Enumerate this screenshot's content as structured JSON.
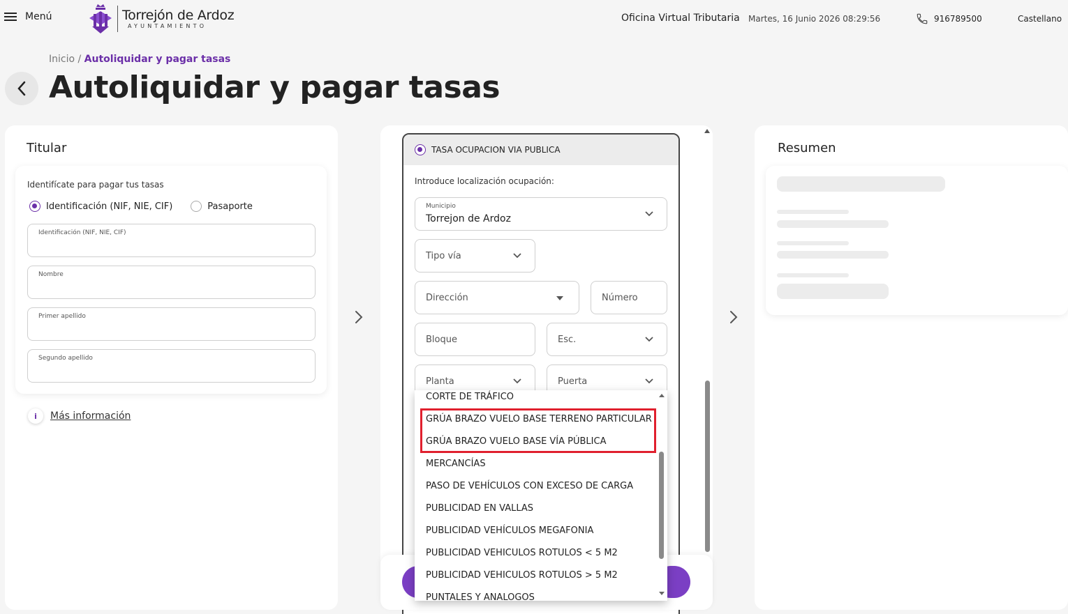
{
  "header": {
    "menu_label": "Menú",
    "logo_title": "Torrejón de Ardoz",
    "logo_subtitle": "AYUNTAMIENTO",
    "office_title": "Oficina Virtual Tributaria",
    "datetime": "Martes, 16 Junio 2026 08:29:56",
    "phone": "916789500",
    "language": "Castellano"
  },
  "breadcrumb": {
    "home": "Inicio",
    "separator": "/",
    "current": "Autoliquidar y pagar tasas"
  },
  "page_title": "Autoliquidar y pagar tasas",
  "titular": {
    "title": "Titular",
    "hint": "Identifícate para pagar tus tasas",
    "radio_options": [
      {
        "label": "Identificación (NIF, NIE, CIF)",
        "selected": true
      },
      {
        "label": "Pasaporte",
        "selected": false
      }
    ],
    "fields": [
      {
        "label": "Identificación (NIF, NIE, CIF)"
      },
      {
        "label": "Nombre"
      },
      {
        "label": "Primer apellido"
      },
      {
        "label": "Segundo apellido"
      }
    ],
    "more_info": "Más información"
  },
  "tasa": {
    "title": "TASA OCUPACION VIA PUBLICA",
    "location_hint": "Introduce localización ocupación:",
    "municipio_label": "Municipio",
    "municipio_value": "Torrejon de Ardoz",
    "tipo_via": "Tipo vía",
    "direccion": "Dirección",
    "numero": "Número",
    "bloque": "Bloque",
    "escalera": "Esc.",
    "planta": "Planta",
    "puerta": "Puerta"
  },
  "dropdown": {
    "items": [
      "CORTE DE TRÁFICO",
      "GRÚA BRAZO VUELO BASE TERRENO PARTICULAR",
      "GRÚA BRAZO VUELO BASE VÍA PÚBLICA",
      "MERCANCÍAS",
      "PASO DE VEHÍCULOS CON EXCESO DE CARGA",
      "PUBLICIDAD EN VALLAS",
      "PUBLICIDAD VEHÍCULOS MEGAFONIA",
      "PUBLICIDAD VEHICULOS ROTULOS < 5 M2",
      "PUBLICIDAD VEHICULOS ROTULOS > 5 M2",
      "PUNTALES Y ANALOGOS"
    ],
    "highlight_color": "#e0202e"
  },
  "resumen": {
    "title": "Resumen"
  },
  "colors": {
    "accent": "#6b2fa8",
    "button": "#7b3fc4"
  }
}
